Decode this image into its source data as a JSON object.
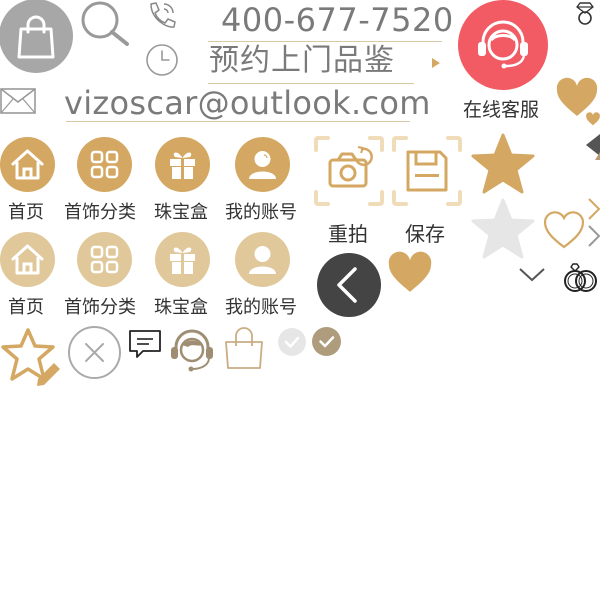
{
  "contact": {
    "phone": "400-677-7520",
    "booking_label": "预约上门品鉴",
    "email": "vizoscar@outlook.com",
    "online_service_label": "在线客服"
  },
  "nav_active": {
    "home": "首页",
    "category": "首饰分类",
    "jewelry_box": "珠宝盒",
    "account": "我的账号"
  },
  "nav_inactive": {
    "home": "首页",
    "category": "首饰分类",
    "jewelry_box": "珠宝盒",
    "account": "我的账号"
  },
  "camera": {
    "retake_label": "重拍",
    "save_label": "保存"
  },
  "colors": {
    "gold": "#d4a862",
    "gold_light": "#e0c89a",
    "gray": "#a7a7a7",
    "red": "#f25a64",
    "dark": "#444444",
    "checked_brown": "#ae9c7c"
  },
  "icons": [
    "shopping-bag-icon",
    "search-icon",
    "phone-icon",
    "clock-icon",
    "email-icon",
    "customer-service-icon",
    "diamond-ring-icon",
    "heart-icon",
    "star-icon",
    "camera-icon",
    "save-icon",
    "back-arrow-icon",
    "chevron-down-icon",
    "wedding-rings-icon",
    "edit-star-icon",
    "close-icon",
    "comment-icon",
    "headset-avatar-icon",
    "check-icon"
  ]
}
